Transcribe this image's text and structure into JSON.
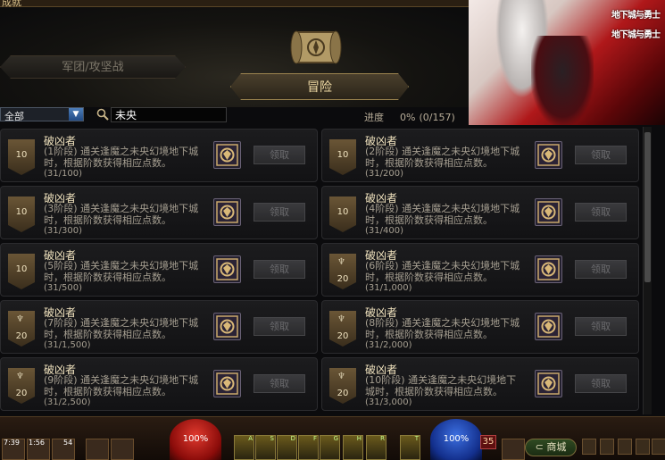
{
  "window": {
    "title": "成就"
  },
  "tabs": {
    "left": "军团/攻坚战",
    "active": "冒险"
  },
  "filter": {
    "dropdown_value": "全部",
    "search_value": "未央",
    "progress_label": "进度",
    "progress_value": "0%",
    "progress_count": "(0/157)"
  },
  "banner": {
    "logo_top": "地下城与勇士",
    "logo_bottom": "地下城与勇士"
  },
  "achievements": [
    {
      "title": "破凶者",
      "desc": "(1阶段) 通关逢魔之未央幻境地下城时，根据阶数获得相应点数。",
      "count": "(31/100)",
      "points": "10",
      "trophy": false,
      "claim": "领取"
    },
    {
      "title": "破凶者",
      "desc": "(2阶段) 通关逢魔之未央幻境地下城时，根据阶数获得相应点数。",
      "count": "(31/200)",
      "points": "10",
      "trophy": false,
      "claim": "领取"
    },
    {
      "title": "破凶者",
      "desc": "(3阶段) 通关逢魔之未央幻境地下城时，根据阶数获得相应点数。",
      "count": "(31/300)",
      "points": "10",
      "trophy": false,
      "claim": "领取"
    },
    {
      "title": "破凶者",
      "desc": "(4阶段) 通关逢魔之未央幻境地下城时，根据阶数获得相应点数。",
      "count": "(31/400)",
      "points": "10",
      "trophy": false,
      "claim": "领取"
    },
    {
      "title": "破凶者",
      "desc": "(5阶段) 通关逢魔之未央幻境地下城时，根据阶数获得相应点数。",
      "count": "(31/500)",
      "points": "10",
      "trophy": false,
      "claim": "领取"
    },
    {
      "title": "破凶者",
      "desc": "(6阶段) 通关逢魔之未央幻境地下城时，根据阶数获得相应点数。",
      "count": "(31/1,000)",
      "points": "20",
      "trophy": true,
      "claim": "领取"
    },
    {
      "title": "破凶者",
      "desc": "(7阶段) 通关逢魔之未央幻境地下城时，根据阶数获得相应点数。",
      "count": "(31/1,500)",
      "points": "20",
      "trophy": true,
      "claim": "领取"
    },
    {
      "title": "破凶者",
      "desc": "(8阶段) 通关逢魔之未央幻境地下城时，根据阶数获得相应点数。",
      "count": "(31/2,000)",
      "points": "20",
      "trophy": true,
      "claim": "领取"
    },
    {
      "title": "破凶者",
      "desc": "(9阶段) 通关逢魔之未央幻境地下城时，根据阶数获得相应点数。",
      "count": "(31/2,500)",
      "points": "20",
      "trophy": true,
      "claim": "领取"
    },
    {
      "title": "破凶者",
      "desc": "(10阶段) 通关逢魔之未央幻境地下城时，根据阶数获得相应点数。",
      "count": "(31/3,000)",
      "points": "20",
      "trophy": true,
      "claim": "领取"
    }
  ],
  "hud": {
    "slots": [
      "7:39",
      "1:56",
      "54"
    ],
    "hp_label": "100%",
    "mp_label": "100%",
    "level": "35",
    "town_label": "商城",
    "skill_keys": [
      "A",
      "S",
      "D",
      "F",
      "G",
      "H",
      "R",
      "T"
    ]
  }
}
